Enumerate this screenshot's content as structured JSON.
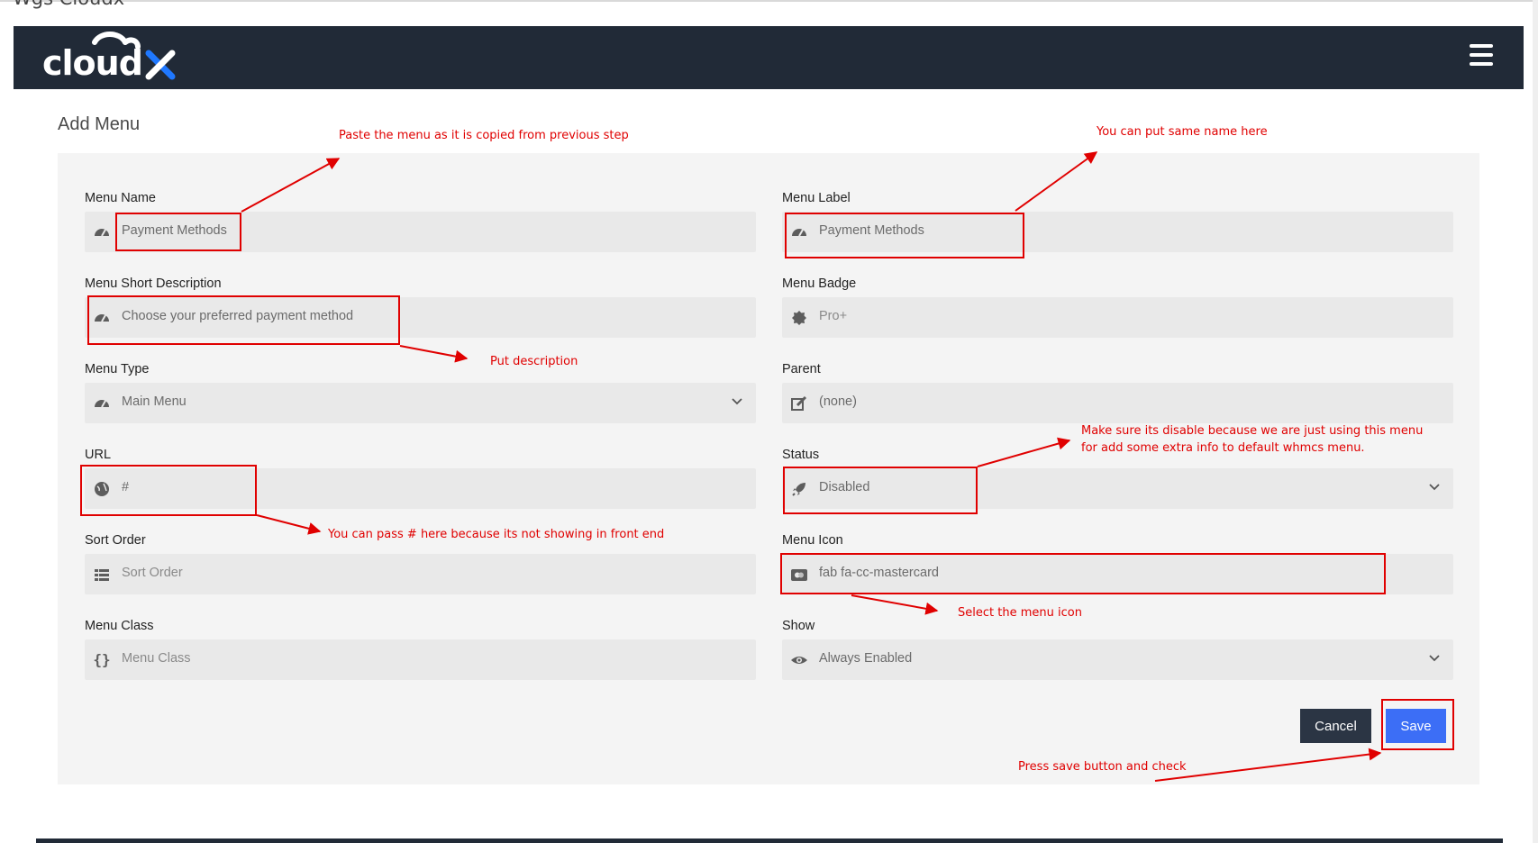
{
  "window": {
    "title": "Wgs Cloudx"
  },
  "header": {
    "logo_text": "cloudx",
    "menu_icon": "hamburger-menu-icon"
  },
  "page": {
    "title": "Add Menu"
  },
  "form": {
    "menu_name": {
      "label": "Menu Name",
      "value": "Payment Methods",
      "icon": "dashboard-gauge-icon"
    },
    "menu_label": {
      "label": "Menu Label",
      "value": "Payment Methods",
      "icon": "dashboard-gauge-icon"
    },
    "short_description": {
      "label": "Menu Short Description",
      "value": "Choose your preferred payment method",
      "icon": "dashboard-gauge-icon"
    },
    "badge": {
      "label": "Menu Badge",
      "value": "Pro+",
      "icon": "badge-icon"
    },
    "menu_type": {
      "label": "Menu Type",
      "value": "Main Menu",
      "icon": "dashboard-gauge-icon"
    },
    "parent": {
      "label": "Parent",
      "value": "(none)",
      "icon": "edit-icon"
    },
    "url": {
      "label": "URL",
      "value": "#",
      "icon": "globe-icon"
    },
    "status": {
      "label": "Status",
      "value": "Disabled",
      "icon": "rocket-icon"
    },
    "sort_order": {
      "label": "Sort Order",
      "placeholder": "Sort Order",
      "icon": "list-icon"
    },
    "menu_icon": {
      "label": "Menu Icon",
      "value": "fab fa-cc-mastercard",
      "icon": "credit-card-icon"
    },
    "menu_class": {
      "label": "Menu Class",
      "placeholder": "Menu Class",
      "icon": "braces-icon"
    },
    "show": {
      "label": "Show",
      "value": "Always Enabled",
      "icon": "eye-icon"
    },
    "cancel_label": "Cancel",
    "save_label": "Save"
  },
  "annotations": {
    "paste_menu": "Paste the menu as it is copied from previous step",
    "same_name": "You can put same name here",
    "description": "Put description",
    "disable_line1": "Make sure its disable because we are just using this menu",
    "disable_line2": "for add some extra info to default whmcs menu.",
    "url_hash": "You can pass # here because its not showing in front end",
    "select_icon": "Select the menu icon",
    "press_save": "Press save button and check"
  },
  "colors": {
    "navbar": "#212a37",
    "save_button": "#3c6ef6",
    "cancel_button": "#2b3544",
    "annotation": "#e00000",
    "field_bg": "#e9e9e9",
    "card_bg": "#f4f4f4"
  }
}
